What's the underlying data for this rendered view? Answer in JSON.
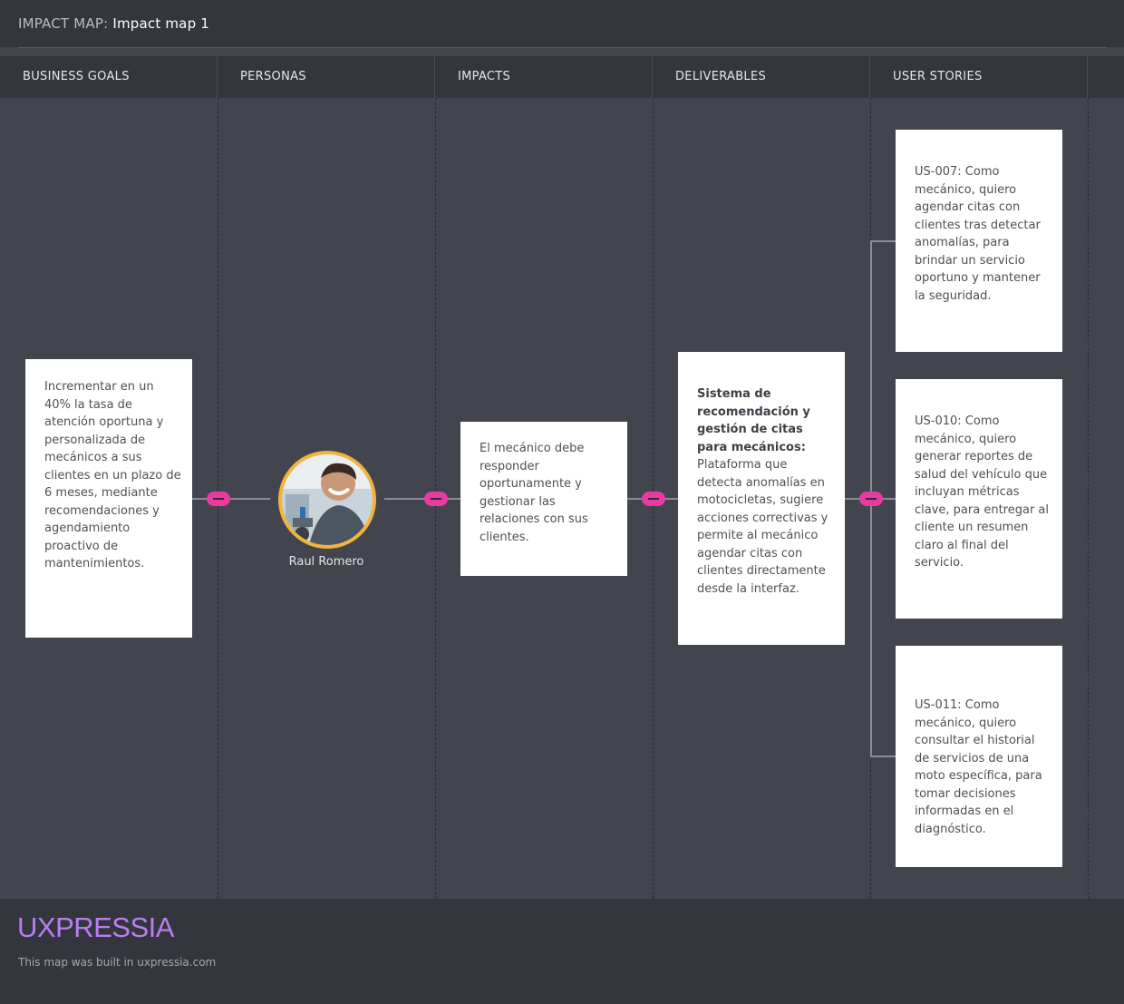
{
  "header": {
    "label": "IMPACT MAP:",
    "map_name": "Impact map 1"
  },
  "columns": [
    "BUSINESS GOALS",
    "PERSONAS",
    "IMPACTS",
    "DELIVERABLES",
    "USER STORIES"
  ],
  "business_goal": {
    "text": "Incrementar en un 40% la tasa de atención oportuna y personalizada de mecánicos a sus clientes en un plazo de 6 meses, mediante recomendaciones y agendamiento proactivo de mantenimientos."
  },
  "persona": {
    "name": "Raul Romero"
  },
  "impact": {
    "text": "El mecánico debe responder oportunamente y gestionar las relaciones con sus clientes."
  },
  "deliverable": {
    "title": "Sistema de recomendación y gestión de citas para mecánicos:",
    "text": "Plataforma que detecta anomalías en motocicletas, sugiere acciones correctivas y permite al mecánico agendar citas con clientes directamente desde la interfaz."
  },
  "user_stories": [
    {
      "text": "US-007: Como mecánico, quiero agendar citas con clientes tras detectar anomalías, para brindar un servicio oportuno y mantener la seguridad."
    },
    {
      "text": "US-010: Como mecánico, quiero generar reportes de salud del vehículo que incluyan métricas clave, para entregar al cliente un resumen claro al final del servicio."
    },
    {
      "text": "US-011: Como mecánico, quiero consultar el historial de servicios de una moto específica, para tomar decisiones informadas en el diagnóstico."
    }
  ],
  "footer": {
    "logo": "UXPRESSIA",
    "built_text": "This map was built in uxpressia.com"
  },
  "colors": {
    "accent": "#e93aa2",
    "avatar_ring": "#f1b53c",
    "logo": "#b97ff0"
  },
  "icons": [
    "collapse-toggle-icon",
    "persona-avatar-photo"
  ]
}
